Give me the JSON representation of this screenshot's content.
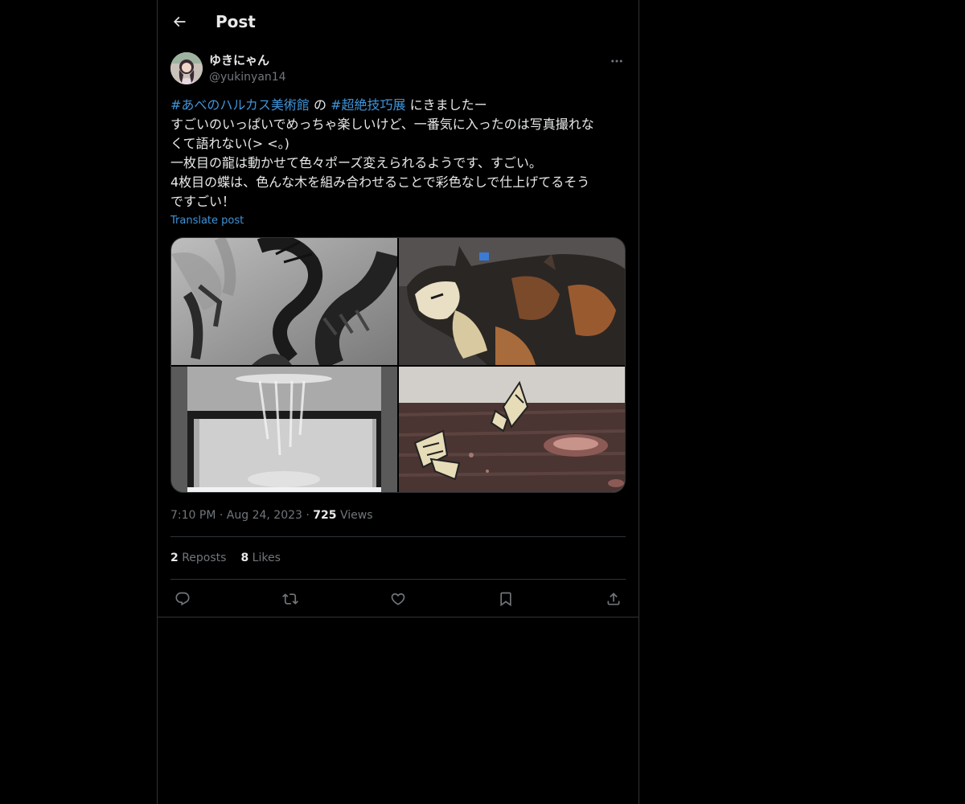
{
  "header": {
    "back_icon": "arrow-left-icon",
    "title": "Post"
  },
  "author": {
    "display_name": "ゆきにゃん",
    "handle": "@yukinyan14",
    "more_icon": "more-horizontal-icon"
  },
  "tweet": {
    "line1": {
      "hashtag1": "#あべのハルカス美術館",
      "connector": " の ",
      "hashtag2": "#超絶技巧展",
      "tail": " にきましたー"
    },
    "lines": [
      "すごいのいっぱいでめっちゃ楽しいけど、一番気に入ったのは写真撮れな",
      "くて語れない(> <。)",
      "一枚目の龍は動かせて色々ポーズ変えられるようです、すごい。",
      "4枚目の蝶は、色んな木を組み合わせることで彩色なしで仕上げてるそう",
      "ですごい！"
    ],
    "translate_label": "Translate post"
  },
  "media": [
    {
      "icon": "dragon-sculpture-photo"
    },
    {
      "icon": "cat-sculpture-photo"
    },
    {
      "icon": "glass-case-sculpture-photo"
    },
    {
      "icon": "butterfly-wood-sculpture-photo"
    }
  ],
  "meta": {
    "time": "7:10 PM",
    "separator": " · ",
    "date": "Aug 24, 2023",
    "views_count": "725",
    "views_label": " Views"
  },
  "stats": {
    "reposts_count": "2",
    "reposts_label": " Reposts",
    "likes_count": "8",
    "likes_label": " Likes"
  },
  "actions": [
    {
      "icon": "reply-icon"
    },
    {
      "icon": "repost-icon"
    },
    {
      "icon": "like-icon"
    },
    {
      "icon": "bookmark-icon"
    },
    {
      "icon": "share-icon"
    }
  ],
  "colors": {
    "background": "#000000",
    "text": "#e7e9ea",
    "secondary": "#71767b",
    "link": "#3f94d9",
    "border": "#2f3336"
  }
}
